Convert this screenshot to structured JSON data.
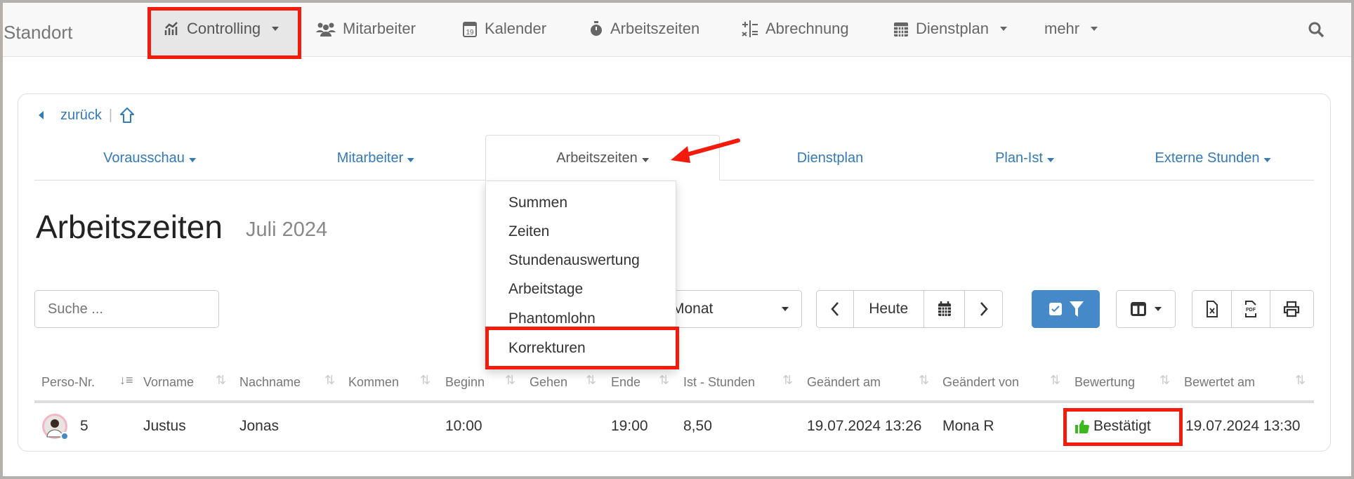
{
  "navbar": {
    "brand": "Standort",
    "items": [
      {
        "label": "Controlling",
        "icon": "chart-icon",
        "dropdown": true,
        "active": true
      },
      {
        "label": "Mitarbeiter",
        "icon": "users-icon"
      },
      {
        "label": "Kalender",
        "icon": "calendar-icon"
      },
      {
        "label": "Arbeitszeiten",
        "icon": "stopwatch-icon"
      },
      {
        "label": "Abrechnung",
        "icon": "calculator-icon"
      },
      {
        "label": "Dienstplan",
        "icon": "calendar-grid-icon",
        "dropdown": true
      },
      {
        "label": "mehr",
        "dropdown": true
      }
    ],
    "search_icon": "search-icon"
  },
  "breadcrumb": {
    "back": "zurück",
    "separator": "|"
  },
  "tabs": [
    {
      "label": "Vorausschau",
      "dropdown": true
    },
    {
      "label": "Mitarbeiter",
      "dropdown": true
    },
    {
      "label": "Arbeitszeiten",
      "dropdown": true,
      "active": true
    },
    {
      "label": "Dienstplan"
    },
    {
      "label": "Plan-Ist",
      "dropdown": true
    },
    {
      "label": "Externe Stunden",
      "dropdown": true
    }
  ],
  "dropdown_menu": [
    "Summen",
    "Zeiten",
    "Stundenauswertung",
    "Arbeitstage",
    "Phantomlohn",
    "Korrekturen"
  ],
  "page": {
    "title": "Arbeitszeiten",
    "subtitle": "Juli 2024"
  },
  "toolbar": {
    "search_placeholder": "Suche ...",
    "period_select": "Monat",
    "today": "Heute"
  },
  "table": {
    "headers": [
      "Perso-Nr.",
      "Vorname",
      "Nachname",
      "Kommen",
      "Beginn",
      "Gehen",
      "Ende",
      "Ist - Stunden",
      "Geändert am",
      "Geändert von",
      "Bewertung",
      "Bewertet am"
    ],
    "rows": [
      {
        "perso_nr": "5",
        "vorname": "Justus",
        "nachname": "Jonas",
        "kommen": "",
        "beginn": "10:00",
        "gehen": "",
        "ende": "19:00",
        "ist_stunden": "8,50",
        "geaendert_am": "19.07.2024 13:26",
        "geaendert_von": "Mona R",
        "bewertung": "Bestätigt",
        "bewertet_am": "19.07.2024 13:30"
      }
    ]
  },
  "colors": {
    "accent": "#337ab7",
    "filter_button": "#4589c9",
    "highlight": "#f41a0c",
    "confirmed": "#3cb81c"
  }
}
